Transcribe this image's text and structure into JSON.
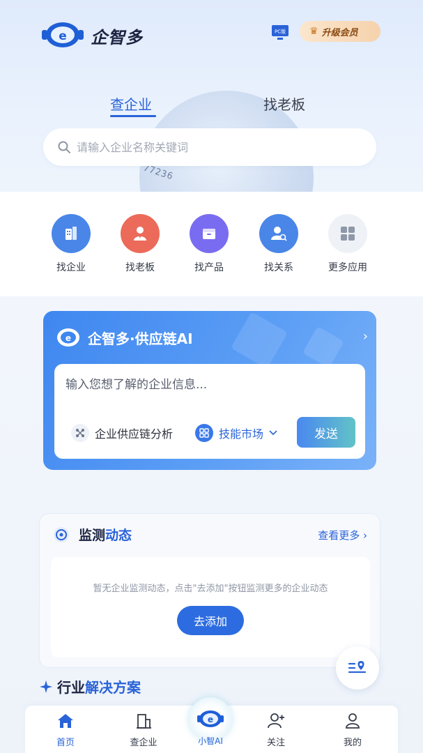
{
  "header": {
    "app_name": "企智多",
    "pc_badge": "PC版",
    "vip_label": "升级会员"
  },
  "tabs": [
    {
      "label": "查企业",
      "active": true
    },
    {
      "label": "找老板",
      "active": false
    }
  ],
  "search": {
    "placeholder": "请输入企业名称关键词"
  },
  "globe_digits": "77236",
  "quick_actions": [
    {
      "label": "找企业",
      "icon": "building-icon",
      "color": "#4a86e8"
    },
    {
      "label": "找老板",
      "icon": "person-icon",
      "color": "#ec6a5a"
    },
    {
      "label": "找产品",
      "icon": "box-icon",
      "color": "#7a6cf0"
    },
    {
      "label": "找关系",
      "icon": "person-search-icon",
      "color": "#4a86e8"
    },
    {
      "label": "更多应用",
      "icon": "grid-icon",
      "color": "#eef1f6"
    }
  ],
  "ai_card": {
    "title": "企智多·供应链AI",
    "input_placeholder": "输入您想了解的企业信息...",
    "chip_analysis": "企业供应链分析",
    "chip_market": "技能市场",
    "send": "发送"
  },
  "monitor": {
    "title_plain": "监测",
    "title_accent": "动态",
    "more": "查看更多",
    "empty_text": "暂无企业监测动态，点击\"去添加\"按钮监测更多的企业动态",
    "add_button": "去添加"
  },
  "industry": {
    "title_plain": "行业",
    "title_accent": "解决方案"
  },
  "tabbar": {
    "home": "首页",
    "company": "查企业",
    "ai": "小智AI",
    "follow": "关注",
    "mine": "我的"
  },
  "colors": {
    "primary": "#2a63d8",
    "vip_gold": "#f6d2ac"
  }
}
